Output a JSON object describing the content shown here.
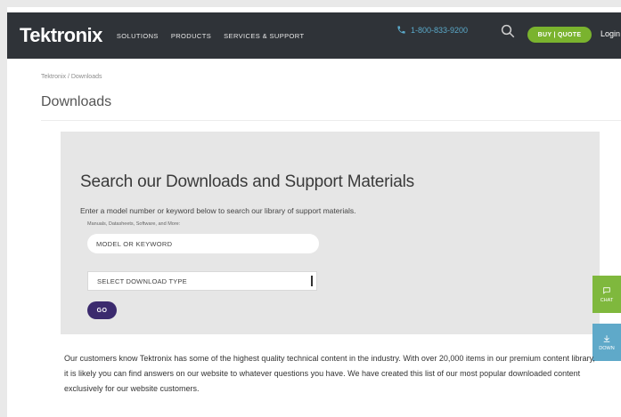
{
  "header": {
    "logo_text": "Tektronix",
    "nav": [
      "SOLUTIONS",
      "PRODUCTS",
      "SERVICES & SUPPORT"
    ],
    "phone": "1-800-833-9200",
    "buy_button": "BUY | QUOTE",
    "login": "Login",
    "colors": {
      "bar": "#2f3338",
      "accent_green": "#7ab32e",
      "phone_blue": "#5aa9c9"
    }
  },
  "breadcrumb": "Tektronix / Downloads",
  "page_title": "Downloads",
  "search_panel": {
    "heading": "Search our Downloads and Support Materials",
    "description": "Enter a model number or keyword below to search our library of support materials.",
    "field_label": "Manuals, Datasheets, Software, and More:",
    "input_placeholder": "MODEL OR KEYWORD",
    "select_value": "SELECT DOWNLOAD TYPE",
    "go_button": "GO",
    "go_color": "#3b2a6e"
  },
  "side_tabs": [
    {
      "label": "CHAT",
      "icon": "chat-icon"
    },
    {
      "label": "DOWN",
      "icon": "download-icon"
    }
  ],
  "intro_text": "Our customers know Tektronix has some of the highest quality technical content in the industry. With over 20,000 items in our premium content library, it is likely you can find answers on our website to whatever questions you have. We have created this list of our most popular downloaded content exclusively for our website customers."
}
